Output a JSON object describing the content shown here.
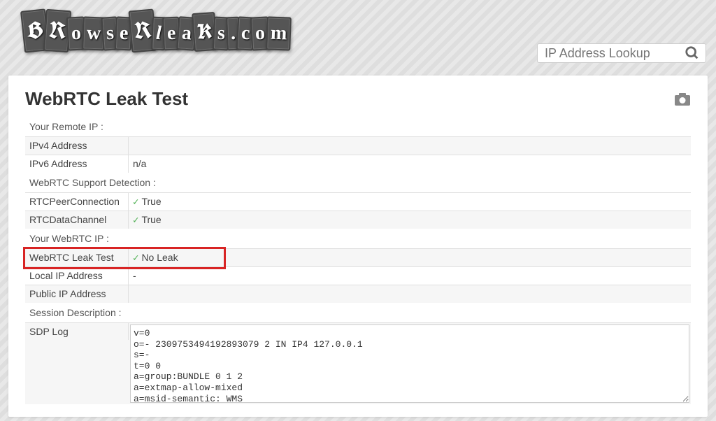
{
  "header": {
    "logo_text": "BRowseRleaKs.com",
    "search_placeholder": "IP Address Lookup"
  },
  "page": {
    "title": "WebRTC Leak Test"
  },
  "sections": {
    "remote_ip": {
      "heading": "Your Remote IP :",
      "ipv4_label": "IPv4 Address",
      "ipv4_value": "",
      "ipv6_label": "IPv6 Address",
      "ipv6_value": "n/a"
    },
    "support": {
      "heading": "WebRTC Support Detection :",
      "peer_label": "RTCPeerConnection",
      "peer_value": "True",
      "data_label": "RTCDataChannel",
      "data_value": "True"
    },
    "webrtc_ip": {
      "heading": "Your WebRTC IP :",
      "leak_label": "WebRTC Leak Test",
      "leak_value": "No Leak",
      "local_label": "Local IP Address",
      "local_value": "-",
      "public_label": "Public IP Address",
      "public_value": ""
    },
    "session": {
      "heading": "Session Description :",
      "sdp_label": "SDP Log",
      "sdp_value": "v=0\no=- 2309753494192893079 2 IN IP4 127.0.0.1\ns=-\nt=0 0\na=group:BUNDLE 0 1 2\na=extmap-allow-mixed\na=msid-semantic: WMS"
    }
  }
}
